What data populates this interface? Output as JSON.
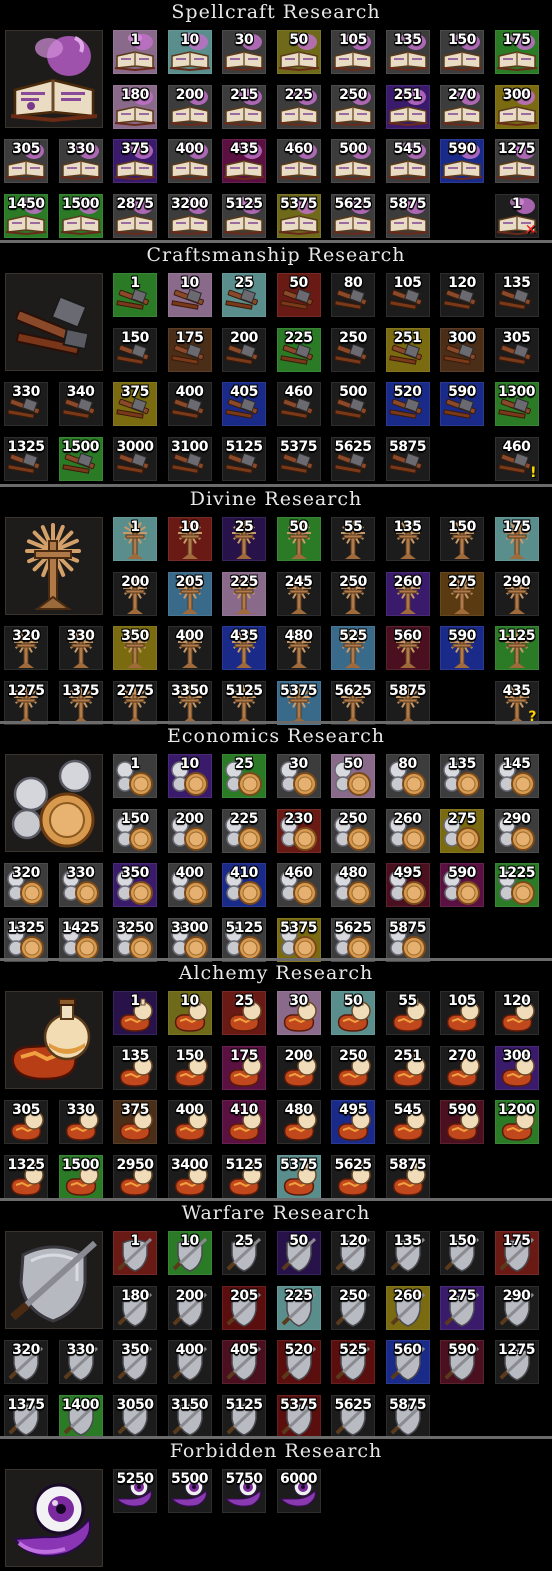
{
  "colors": {
    "gray": "#3c3c3c",
    "teal": "#5a8e8c",
    "lilac": "#8a6a8a",
    "olive": "#6e6a1a",
    "green": "#2a7a26",
    "gold": "#7a6a10",
    "purple": "#3a1a6a",
    "magenta": "#5a1040",
    "blue": "#1a2a88",
    "red": "#6a1a14",
    "brown": "#4a2e18",
    "dark": "#1c1c1c",
    "wine": "#4a1020",
    "steelblue": "#3a6a8a",
    "darkpurple": "#28124a",
    "amber": "#5a3a10",
    "lightgray": "#6a6a6a",
    "darkred": "#5a0e0e"
  },
  "sections": [
    {
      "title": "Spellcraft Research",
      "icon": "spellbook-icon",
      "cells": [
        {
          "v": "1",
          "c": "lilac"
        },
        {
          "v": "10",
          "c": "teal"
        },
        {
          "v": "30",
          "c": "gray"
        },
        {
          "v": "50",
          "c": "olive"
        },
        {
          "v": "105",
          "c": "gray"
        },
        {
          "v": "135",
          "c": "gray"
        },
        {
          "v": "150",
          "c": "gray"
        },
        {
          "v": "175",
          "c": "green"
        },
        {
          "v": "180",
          "c": "lilac"
        },
        {
          "v": "200",
          "c": "gray"
        },
        {
          "v": "215",
          "c": "gray"
        },
        {
          "v": "225",
          "c": "gray"
        },
        {
          "v": "250",
          "c": "gray"
        },
        {
          "v": "251",
          "c": "purple"
        },
        {
          "v": "270",
          "c": "gray"
        },
        {
          "v": "300",
          "c": "gold"
        },
        {
          "v": "305",
          "c": "gray"
        },
        {
          "v": "330",
          "c": "gray"
        },
        {
          "v": "375",
          "c": "purple"
        },
        {
          "v": "400",
          "c": "gray"
        },
        {
          "v": "435",
          "c": "magenta"
        },
        {
          "v": "460",
          "c": "gray"
        },
        {
          "v": "500",
          "c": "gray"
        },
        {
          "v": "545",
          "c": "gray"
        },
        {
          "v": "590",
          "c": "blue"
        },
        {
          "v": "1275",
          "c": "gray"
        },
        {
          "v": "1450",
          "c": "green"
        },
        {
          "v": "1500",
          "c": "green"
        },
        {
          "v": "2875",
          "c": "gray"
        },
        {
          "v": "3200",
          "c": "gray"
        },
        {
          "v": "5125",
          "c": "gray"
        },
        {
          "v": "5375",
          "c": "olive"
        },
        {
          "v": "5625",
          "c": "gray"
        },
        {
          "v": "5875",
          "c": "gray"
        }
      ],
      "extra": {
        "v": "1",
        "mark": "✕",
        "kind": "x"
      }
    },
    {
      "title": "Craftsmanship Research",
      "icon": "hammer-icon",
      "cells": [
        {
          "v": "1",
          "c": "green"
        },
        {
          "v": "10",
          "c": "lilac"
        },
        {
          "v": "25",
          "c": "teal"
        },
        {
          "v": "50",
          "c": "red"
        },
        {
          "v": "80",
          "c": "dark"
        },
        {
          "v": "105",
          "c": "dark"
        },
        {
          "v": "120",
          "c": "dark"
        },
        {
          "v": "135",
          "c": "dark"
        },
        {
          "v": "150",
          "c": "dark"
        },
        {
          "v": "175",
          "c": "brown"
        },
        {
          "v": "200",
          "c": "dark"
        },
        {
          "v": "225",
          "c": "green"
        },
        {
          "v": "250",
          "c": "dark"
        },
        {
          "v": "251",
          "c": "gold"
        },
        {
          "v": "300",
          "c": "brown"
        },
        {
          "v": "305",
          "c": "dark"
        },
        {
          "v": "330",
          "c": "dark"
        },
        {
          "v": "340",
          "c": "dark"
        },
        {
          "v": "375",
          "c": "gold"
        },
        {
          "v": "400",
          "c": "dark"
        },
        {
          "v": "405",
          "c": "blue"
        },
        {
          "v": "460",
          "c": "dark"
        },
        {
          "v": "500",
          "c": "dark"
        },
        {
          "v": "520",
          "c": "blue"
        },
        {
          "v": "590",
          "c": "blue"
        },
        {
          "v": "1300",
          "c": "green"
        },
        {
          "v": "1325",
          "c": "dark"
        },
        {
          "v": "1500",
          "c": "green"
        },
        {
          "v": "3000",
          "c": "dark"
        },
        {
          "v": "3100",
          "c": "dark"
        },
        {
          "v": "5125",
          "c": "dark"
        },
        {
          "v": "5375",
          "c": "dark"
        },
        {
          "v": "5625",
          "c": "dark"
        },
        {
          "v": "5875",
          "c": "dark"
        }
      ],
      "extra": {
        "v": "460",
        "mark": "!",
        "kind": "ex"
      }
    },
    {
      "title": "Divine Research",
      "icon": "sunburst-cross-icon",
      "cells": [
        {
          "v": "1",
          "c": "teal"
        },
        {
          "v": "10",
          "c": "red"
        },
        {
          "v": "25",
          "c": "darkpurple"
        },
        {
          "v": "50",
          "c": "green"
        },
        {
          "v": "55",
          "c": "dark"
        },
        {
          "v": "135",
          "c": "dark"
        },
        {
          "v": "150",
          "c": "dark"
        },
        {
          "v": "175",
          "c": "teal"
        },
        {
          "v": "200",
          "c": "dark"
        },
        {
          "v": "205",
          "c": "steelblue"
        },
        {
          "v": "225",
          "c": "lilac"
        },
        {
          "v": "245",
          "c": "dark"
        },
        {
          "v": "250",
          "c": "dark"
        },
        {
          "v": "260",
          "c": "purple"
        },
        {
          "v": "275",
          "c": "amber"
        },
        {
          "v": "290",
          "c": "dark"
        },
        {
          "v": "320",
          "c": "dark"
        },
        {
          "v": "330",
          "c": "dark"
        },
        {
          "v": "350",
          "c": "gold"
        },
        {
          "v": "400",
          "c": "dark"
        },
        {
          "v": "435",
          "c": "blue"
        },
        {
          "v": "480",
          "c": "dark"
        },
        {
          "v": "525",
          "c": "steelblue"
        },
        {
          "v": "560",
          "c": "wine"
        },
        {
          "v": "590",
          "c": "blue"
        },
        {
          "v": "1125",
          "c": "green"
        },
        {
          "v": "1275",
          "c": "dark"
        },
        {
          "v": "1375",
          "c": "dark"
        },
        {
          "v": "2775",
          "c": "dark"
        },
        {
          "v": "3350",
          "c": "dark"
        },
        {
          "v": "5125",
          "c": "dark"
        },
        {
          "v": "5375",
          "c": "steelblue"
        },
        {
          "v": "5625",
          "c": "dark"
        },
        {
          "v": "5875",
          "c": "dark"
        }
      ],
      "extra": {
        "v": "435",
        "mark": "?",
        "kind": "q"
      }
    },
    {
      "title": "Economics Research",
      "icon": "coins-icon",
      "cells": [
        {
          "v": "1",
          "c": "gray"
        },
        {
          "v": "10",
          "c": "purple"
        },
        {
          "v": "25",
          "c": "green"
        },
        {
          "v": "30",
          "c": "gray"
        },
        {
          "v": "50",
          "c": "lilac"
        },
        {
          "v": "80",
          "c": "gray"
        },
        {
          "v": "135",
          "c": "gray"
        },
        {
          "v": "145",
          "c": "gray"
        },
        {
          "v": "150",
          "c": "gray"
        },
        {
          "v": "200",
          "c": "gray"
        },
        {
          "v": "225",
          "c": "gray"
        },
        {
          "v": "230",
          "c": "red"
        },
        {
          "v": "250",
          "c": "gray"
        },
        {
          "v": "260",
          "c": "gray"
        },
        {
          "v": "275",
          "c": "gold"
        },
        {
          "v": "290",
          "c": "gray"
        },
        {
          "v": "320",
          "c": "gray"
        },
        {
          "v": "330",
          "c": "gray"
        },
        {
          "v": "350",
          "c": "purple"
        },
        {
          "v": "400",
          "c": "gray"
        },
        {
          "v": "410",
          "c": "blue"
        },
        {
          "v": "460",
          "c": "gray"
        },
        {
          "v": "480",
          "c": "gray"
        },
        {
          "v": "495",
          "c": "wine"
        },
        {
          "v": "590",
          "c": "magenta"
        },
        {
          "v": "1225",
          "c": "green"
        },
        {
          "v": "1325",
          "c": "gray"
        },
        {
          "v": "1425",
          "c": "gray"
        },
        {
          "v": "3250",
          "c": "gray"
        },
        {
          "v": "3300",
          "c": "gray"
        },
        {
          "v": "5125",
          "c": "gray"
        },
        {
          "v": "5375",
          "c": "gold"
        },
        {
          "v": "5625",
          "c": "gray"
        },
        {
          "v": "5875",
          "c": "gray"
        }
      ],
      "extra": null
    },
    {
      "title": "Alchemy Research",
      "icon": "potion-icon",
      "cells": [
        {
          "v": "1",
          "c": "darkpurple"
        },
        {
          "v": "10",
          "c": "olive"
        },
        {
          "v": "25",
          "c": "red"
        },
        {
          "v": "30",
          "c": "lilac"
        },
        {
          "v": "50",
          "c": "teal"
        },
        {
          "v": "55",
          "c": "dark"
        },
        {
          "v": "105",
          "c": "dark"
        },
        {
          "v": "120",
          "c": "dark"
        },
        {
          "v": "135",
          "c": "dark"
        },
        {
          "v": "150",
          "c": "dark"
        },
        {
          "v": "175",
          "c": "magenta"
        },
        {
          "v": "200",
          "c": "dark"
        },
        {
          "v": "250",
          "c": "dark"
        },
        {
          "v": "251",
          "c": "dark"
        },
        {
          "v": "270",
          "c": "dark"
        },
        {
          "v": "300",
          "c": "purple"
        },
        {
          "v": "305",
          "c": "dark"
        },
        {
          "v": "330",
          "c": "dark"
        },
        {
          "v": "375",
          "c": "brown"
        },
        {
          "v": "400",
          "c": "dark"
        },
        {
          "v": "410",
          "c": "magenta"
        },
        {
          "v": "480",
          "c": "dark"
        },
        {
          "v": "495",
          "c": "blue"
        },
        {
          "v": "545",
          "c": "dark"
        },
        {
          "v": "590",
          "c": "wine"
        },
        {
          "v": "1200",
          "c": "green"
        },
        {
          "v": "1325",
          "c": "dark"
        },
        {
          "v": "1500",
          "c": "green"
        },
        {
          "v": "2950",
          "c": "dark"
        },
        {
          "v": "3400",
          "c": "dark"
        },
        {
          "v": "5125",
          "c": "dark"
        },
        {
          "v": "5375",
          "c": "teal"
        },
        {
          "v": "5625",
          "c": "dark"
        },
        {
          "v": "5875",
          "c": "dark"
        }
      ],
      "extra": null
    },
    {
      "title": "Warfare Research",
      "icon": "shield-sword-icon",
      "cells": [
        {
          "v": "1",
          "c": "red"
        },
        {
          "v": "10",
          "c": "green"
        },
        {
          "v": "25",
          "c": "dark"
        },
        {
          "v": "50",
          "c": "darkpurple"
        },
        {
          "v": "120",
          "c": "dark"
        },
        {
          "v": "135",
          "c": "dark"
        },
        {
          "v": "150",
          "c": "dark"
        },
        {
          "v": "175",
          "c": "red"
        },
        {
          "v": "180",
          "c": "dark"
        },
        {
          "v": "200",
          "c": "dark"
        },
        {
          "v": "205",
          "c": "darkred"
        },
        {
          "v": "225",
          "c": "teal"
        },
        {
          "v": "250",
          "c": "dark"
        },
        {
          "v": "260",
          "c": "gold"
        },
        {
          "v": "275",
          "c": "purple"
        },
        {
          "v": "290",
          "c": "dark"
        },
        {
          "v": "320",
          "c": "dark"
        },
        {
          "v": "330",
          "c": "dark"
        },
        {
          "v": "350",
          "c": "dark"
        },
        {
          "v": "400",
          "c": "dark"
        },
        {
          "v": "405",
          "c": "wine"
        },
        {
          "v": "520",
          "c": "darkred"
        },
        {
          "v": "525",
          "c": "darkred"
        },
        {
          "v": "560",
          "c": "blue"
        },
        {
          "v": "590",
          "c": "wine"
        },
        {
          "v": "1275",
          "c": "dark"
        },
        {
          "v": "1375",
          "c": "dark"
        },
        {
          "v": "1400",
          "c": "green"
        },
        {
          "v": "3050",
          "c": "dark"
        },
        {
          "v": "3150",
          "c": "dark"
        },
        {
          "v": "5125",
          "c": "dark"
        },
        {
          "v": "5375",
          "c": "darkred"
        },
        {
          "v": "5625",
          "c": "dark"
        },
        {
          "v": "5875",
          "c": "dark"
        }
      ],
      "extra": null
    },
    {
      "title": "Forbidden Research",
      "icon": "eye-icon",
      "cells": [
        {
          "v": "5250",
          "c": "dark"
        },
        {
          "v": "5500",
          "c": "dark"
        },
        {
          "v": "5750",
          "c": "dark"
        },
        {
          "v": "6000",
          "c": "dark"
        }
      ],
      "extra": null
    }
  ]
}
